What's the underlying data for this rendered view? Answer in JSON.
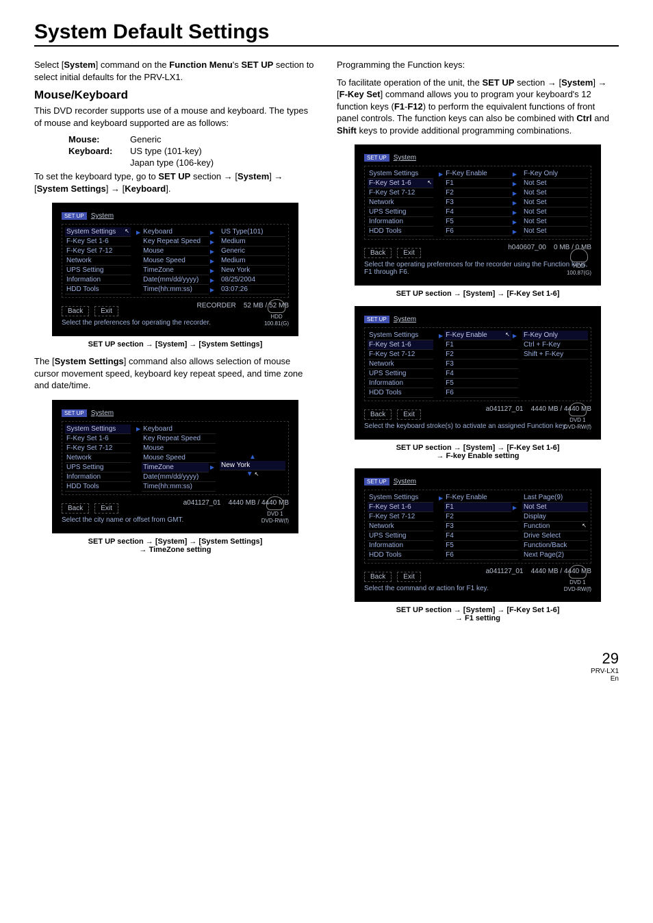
{
  "page_title": "System Default Settings",
  "intro": {
    "prefix": "Select [",
    "system": "System",
    "mid1": "] command on the ",
    "fm": "Function Menu",
    "mid2": "'s ",
    "setup": "SET UP",
    "suffix": " section to select initial defaults for the PRV-LX1."
  },
  "mouse_kbd": {
    "heading": "Mouse/Keyboard",
    "para": "This DVD recorder supports use of a mouse and keyboard. The types of mouse and keyboard supported are as follows:",
    "mouse_label": "Mouse:",
    "mouse_val": "Generic",
    "kbd_label": "Keyboard:",
    "kbd_val1": "US type (101-key)",
    "kbd_val2": "Japan type (106-key)",
    "nav_prefix": "To set the keyboard type, go to ",
    "nav_setup": "SET UP",
    "nav_section": " section ",
    "nav_chain": "[System] → [System Settings] → [Keyboard]"
  },
  "ss1": {
    "setup": "SET UP",
    "title": "System",
    "menu": [
      "System Settings",
      "F-Key Set 1-6",
      "F-Key Set 7-12",
      "Network",
      "UPS Setting",
      "Information",
      "HDD Tools"
    ],
    "mid": [
      "Keyboard",
      "Key Repeat Speed",
      "Mouse",
      "Mouse Speed",
      "TimeZone",
      "Date(mm/dd/yyyy)",
      "Time(hh:mm:ss)"
    ],
    "right": [
      "US Type(101)",
      "Medium",
      "Generic",
      "Medium",
      "New York",
      "08/25/2004",
      "03:07:26"
    ],
    "back": "Back",
    "exit": "Exit",
    "status_left": "RECORDER",
    "status_right": "52 MB /   52 MB",
    "help": "Select the preferences for operating the recorder.",
    "badge": "HDD",
    "badge2": "100.81(G)"
  },
  "caption1": "SET UP section → [System] → [System Settings]",
  "para2": {
    "pre": "The [",
    "b": "System Settings",
    "post": "] command also allows selection of mouse cursor movement speed, keyboard key repeat speed, and time zone and date/time."
  },
  "ss2": {
    "setup": "SET UP",
    "title": "System",
    "menu": [
      "System Settings",
      "F-Key Set 1-6",
      "F-Key Set 7-12",
      "Network",
      "UPS Setting",
      "Information",
      "HDD Tools"
    ],
    "mid": [
      "Keyboard",
      "Key Repeat Speed",
      "Mouse",
      "Mouse Speed",
      "TimeZone",
      "Date(mm/dd/yyyy)",
      "Time(hh:mm:ss)"
    ],
    "right_val": "New York",
    "back": "Back",
    "exit": "Exit",
    "status_left": "a041127_01",
    "status_right": "4440 MB / 4440 MB",
    "help": "Select the city name or offset from GMT.",
    "badge": "DVD 1",
    "badge2": "DVD-RW(f)"
  },
  "caption2a": "SET UP section → [System] → [System Settings]",
  "caption2b": "→ TimeZone setting",
  "right_intro": {
    "line1": "Programming the Function keys:",
    "line2_pre": "To facilitate operation of the unit, the ",
    "line2_setup": "SET UP",
    "line2_mid": " section → [",
    "line2_sys": "System",
    "line2_mid2": "] → [",
    "line2_fk": "F-Key Set",
    "line2_post": "] command allows you to program your keyboard's 12 function keys (",
    "f1": "F1",
    "dash": "-",
    "f12": "F12",
    "line2_post2": ") to perform the equivalent functions of front panel controls. The function keys can also be combined with ",
    "ctrl": "Ctrl",
    "and": " and ",
    "shift": "Shift",
    "line2_end": " keys to provide additional programming combinations."
  },
  "ss3": {
    "setup": "SET UP",
    "title": "System",
    "menu": [
      "System Settings",
      "F-Key Set 1-6",
      "F-Key Set 7-12",
      "Network",
      "UPS Setting",
      "Information",
      "HDD Tools"
    ],
    "mid": [
      "F-Key Enable",
      "F1",
      "F2",
      "F3",
      "F4",
      "F5",
      "F6"
    ],
    "right": [
      "F-Key Only",
      "Not Set",
      "Not Set",
      "Not Set",
      "Not Set",
      "Not Set",
      "Not Set"
    ],
    "back": "Back",
    "exit": "Exit",
    "status_left": "h040607_00",
    "status_right": "0 MB /    0 MB",
    "help": "Select the operating preferences for the recorder using the Function keys, F1 through F6.",
    "badge": "HDD",
    "badge2": "100.87(G)"
  },
  "caption3": "SET UP section → [System] → [F-Key Set 1-6]",
  "ss4": {
    "setup": "SET UP",
    "title": "System",
    "menu": [
      "System Settings",
      "F-Key Set 1-6",
      "F-Key Set 7-12",
      "Network",
      "UPS Setting",
      "Information",
      "HDD Tools"
    ],
    "mid": [
      "F-Key Enable",
      "F1",
      "F2",
      "F3",
      "F4",
      "F5",
      "F6"
    ],
    "right": [
      "F-Key Only",
      "Ctrl + F-Key",
      "Shift + F-Key"
    ],
    "back": "Back",
    "exit": "Exit",
    "status_left": "a041127_01",
    "status_right": "4440 MB / 4440 MB",
    "help": "Select the keyboard stroke(s) to activate an assigned Function key.",
    "badge": "DVD 1",
    "badge2": "DVD-RW(f)"
  },
  "caption4a": "SET UP section → [System] → [F-Key Set 1-6]",
  "caption4b": "→ F-key Enable setting",
  "ss5": {
    "setup": "SET UP",
    "title": "System",
    "menu": [
      "System Settings",
      "F-Key Set 1-6",
      "F-Key Set 7-12",
      "Network",
      "UPS Setting",
      "Information",
      "HDD Tools"
    ],
    "mid": [
      "F-Key Enable",
      "F1",
      "F2",
      "F3",
      "F4",
      "F5",
      "F6"
    ],
    "right": [
      "Last Page(9)",
      "Not Set",
      "Display",
      "Function",
      "Drive Select",
      "Function/Back",
      "Next Page(2)"
    ],
    "back": "Back",
    "exit": "Exit",
    "status_left": "a041127_01",
    "status_right": "4440 MB / 4440 MB",
    "help": "Select the command or action for F1 key.",
    "badge": "DVD 1",
    "badge2": "DVD-RW(f)"
  },
  "caption5a": "SET UP section → [System] → [F-Key Set 1-6]",
  "caption5b": "→ F1 setting",
  "footer": {
    "page": "29",
    "model": "PRV-LX1",
    "lang": "En"
  }
}
